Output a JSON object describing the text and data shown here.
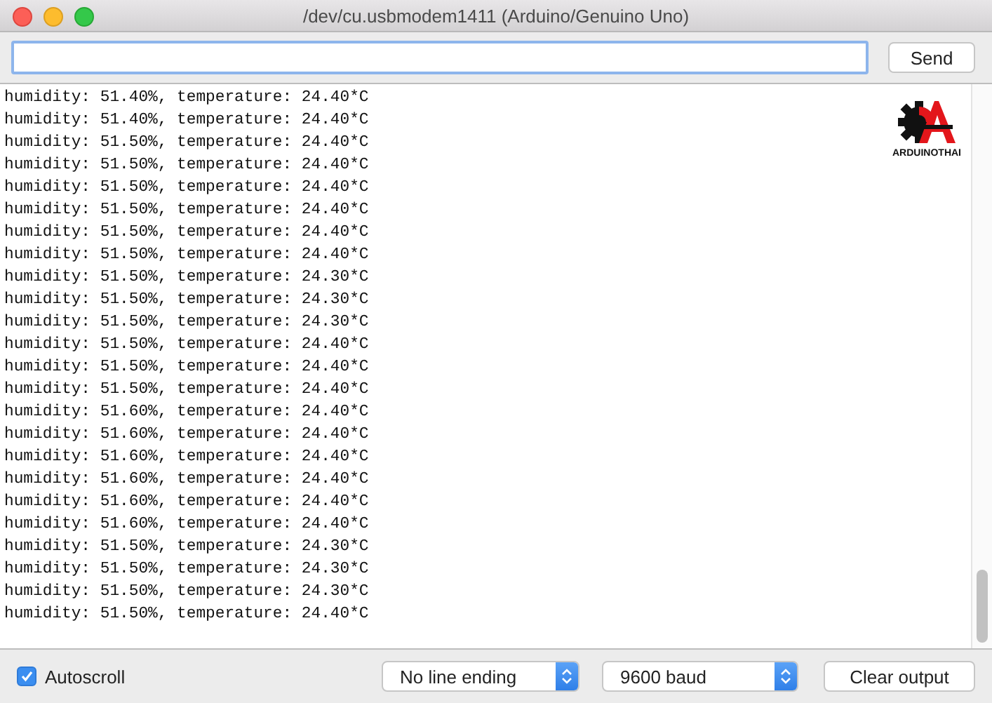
{
  "window": {
    "title": "/dev/cu.usbmodem1411 (Arduino/Genuino Uno)"
  },
  "send_bar": {
    "button": "Send"
  },
  "output": {
    "lines": [
      "humidity: 51.40%, temperature: 24.40*C",
      "humidity: 51.40%, temperature: 24.40*C",
      "humidity: 51.50%, temperature: 24.40*C",
      "humidity: 51.50%, temperature: 24.40*C",
      "humidity: 51.50%, temperature: 24.40*C",
      "humidity: 51.50%, temperature: 24.40*C",
      "humidity: 51.50%, temperature: 24.40*C",
      "humidity: 51.50%, temperature: 24.40*C",
      "humidity: 51.50%, temperature: 24.30*C",
      "humidity: 51.50%, temperature: 24.30*C",
      "humidity: 51.50%, temperature: 24.30*C",
      "humidity: 51.50%, temperature: 24.40*C",
      "humidity: 51.50%, temperature: 24.40*C",
      "humidity: 51.50%, temperature: 24.40*C",
      "humidity: 51.60%, temperature: 24.40*C",
      "humidity: 51.60%, temperature: 24.40*C",
      "humidity: 51.60%, temperature: 24.40*C",
      "humidity: 51.60%, temperature: 24.40*C",
      "humidity: 51.60%, temperature: 24.40*C",
      "humidity: 51.60%, temperature: 24.40*C",
      "humidity: 51.50%, temperature: 24.30*C",
      "humidity: 51.50%, temperature: 24.30*C",
      "humidity: 51.50%, temperature: 24.30*C",
      "humidity: 51.50%, temperature: 24.40*C"
    ],
    "logo_text": "ARDUINOTHAI"
  },
  "footer": {
    "autoscroll": {
      "label": "Autoscroll",
      "checked": true
    },
    "line_ending": "No line ending",
    "baud": "9600 baud",
    "clear_button": "Clear output"
  }
}
